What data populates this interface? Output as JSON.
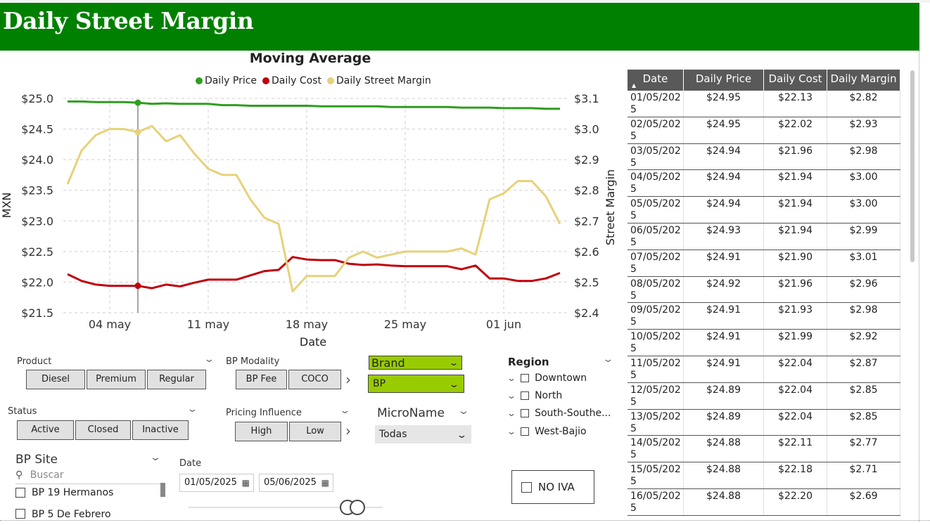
{
  "header": {
    "title": "Daily Street Margin"
  },
  "chart_data": {
    "type": "line",
    "title": "Moving Average",
    "xlabel": "Date",
    "ylabel": "MXN",
    "y2label": "Street Margin",
    "ylim": [
      21.5,
      25.0
    ],
    "y2lim": [
      2.4,
      3.1
    ],
    "yticks": [
      "$25.0",
      "$24.5",
      "$24.0",
      "$23.5",
      "$23.0",
      "$22.5",
      "$22.0",
      "$21.5"
    ],
    "y2ticks": [
      "$3.1",
      "$3.0",
      "$2.9",
      "$2.8",
      "$2.7",
      "$2.6",
      "$2.5",
      "$2.4"
    ],
    "xticks": [
      "04 may",
      "11 may",
      "18 may",
      "25 may",
      "01 jun"
    ],
    "xtick_days": [
      4,
      11,
      18,
      25,
      32
    ],
    "x_day_range": [
      1,
      36
    ],
    "legend_position": "top-center",
    "grid": true,
    "hover_day": 6,
    "series": [
      {
        "name": "Daily Price",
        "axis": "left",
        "color": "#2e9e1e",
        "values": [
          24.95,
          24.95,
          24.94,
          24.94,
          24.94,
          24.93,
          24.91,
          24.92,
          24.91,
          24.91,
          24.91,
          24.89,
          24.89,
          24.88,
          24.88,
          24.88,
          24.88,
          24.88,
          24.87,
          24.87,
          24.87,
          24.87,
          24.87,
          24.86,
          24.86,
          24.86,
          24.86,
          24.86,
          24.85,
          24.85,
          24.85,
          24.84,
          24.84,
          24.84,
          24.83,
          24.83
        ]
      },
      {
        "name": "Daily Cost",
        "axis": "left",
        "color": "#c0000c",
        "values": [
          22.13,
          22.02,
          21.96,
          21.94,
          21.94,
          21.94,
          21.9,
          21.96,
          21.93,
          21.99,
          22.04,
          22.04,
          22.04,
          22.11,
          22.18,
          22.2,
          22.41,
          22.37,
          22.36,
          22.36,
          22.3,
          22.28,
          22.29,
          22.27,
          22.26,
          22.26,
          22.26,
          22.26,
          22.21,
          22.27,
          22.06,
          22.06,
          22.02,
          22.02,
          22.06,
          22.15
        ]
      },
      {
        "name": "Daily Street Margin",
        "axis": "right",
        "color": "#e6d27a",
        "values": [
          2.82,
          2.93,
          2.98,
          3.0,
          3.0,
          2.99,
          3.01,
          2.96,
          2.98,
          2.92,
          2.87,
          2.85,
          2.85,
          2.77,
          2.71,
          2.69,
          2.47,
          2.52,
          2.52,
          2.52,
          2.58,
          2.6,
          2.58,
          2.59,
          2.6,
          2.6,
          2.6,
          2.6,
          2.61,
          2.59,
          2.77,
          2.79,
          2.83,
          2.83,
          2.78,
          2.69
        ]
      }
    ]
  },
  "table": {
    "headers": [
      "Date",
      "Daily Price",
      "Daily Cost",
      "Daily Margin"
    ],
    "rows": [
      [
        "01/05/2025",
        "$24.95",
        "$22.13",
        "$2.82"
      ],
      [
        "02/05/2025",
        "$24.95",
        "$22.02",
        "$2.93"
      ],
      [
        "03/05/2025",
        "$24.94",
        "$21.96",
        "$2.98"
      ],
      [
        "04/05/2025",
        "$24.94",
        "$21.94",
        "$3.00"
      ],
      [
        "05/05/2025",
        "$24.94",
        "$21.94",
        "$3.00"
      ],
      [
        "06/05/2025",
        "$24.93",
        "$21.94",
        "$2.99"
      ],
      [
        "07/05/2025",
        "$24.91",
        "$21.90",
        "$3.01"
      ],
      [
        "08/05/2025",
        "$24.92",
        "$21.96",
        "$2.96"
      ],
      [
        "09/05/2025",
        "$24.91",
        "$21.93",
        "$2.98"
      ],
      [
        "10/05/2025",
        "$24.91",
        "$21.99",
        "$2.92"
      ],
      [
        "11/05/2025",
        "$24.91",
        "$22.04",
        "$2.87"
      ],
      [
        "12/05/2025",
        "$24.89",
        "$22.04",
        "$2.85"
      ],
      [
        "13/05/2025",
        "$24.89",
        "$22.04",
        "$2.85"
      ],
      [
        "14/05/2025",
        "$24.88",
        "$22.11",
        "$2.77"
      ],
      [
        "15/05/2025",
        "$24.88",
        "$22.18",
        "$2.71"
      ],
      [
        "16/05/2025",
        "$24.88",
        "$22.20",
        "$2.69"
      ]
    ]
  },
  "slicers": {
    "product": {
      "label": "Product",
      "options": [
        "Diesel",
        "Premium",
        "Regular"
      ]
    },
    "bp_modality": {
      "label": "BP Modality",
      "options": [
        "BP Fee",
        "COCO"
      ]
    },
    "brand": {
      "label": "Brand",
      "value": "BP"
    },
    "region": {
      "label": "Region",
      "items": [
        "Downtown",
        "North",
        "South-Southe...",
        "West-Bajio"
      ]
    },
    "status": {
      "label": "Status",
      "options": [
        "Active",
        "Closed",
        "Inactive"
      ]
    },
    "pricing_influence": {
      "label": "Pricing Influence",
      "options": [
        "High",
        "Low"
      ]
    },
    "micro_name": {
      "label": "MicroName",
      "value": "Todas"
    },
    "bp_site": {
      "label": "BP Site",
      "search_placeholder": "Buscar",
      "items": [
        "BP 19 Hermanos",
        "BP 5 De Febrero"
      ]
    },
    "date": {
      "label": "Date",
      "start": "01/05/2025",
      "end": "05/06/2025"
    },
    "no_iva": {
      "label": "NO IVA"
    }
  },
  "colors": {
    "header_bg": "#008000",
    "slicer_green": "#99cc00",
    "table_header": "#595959"
  }
}
